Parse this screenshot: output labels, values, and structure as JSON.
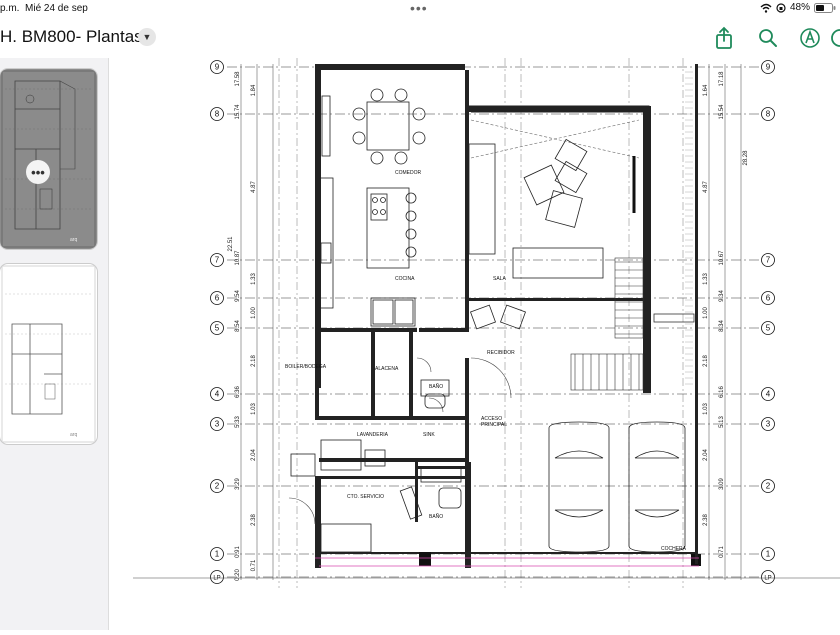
{
  "status": {
    "time": "p.m.",
    "date": "Mié 24 de sep",
    "battery": "48%"
  },
  "toolbar": {
    "title": "H. BM800- Plantas",
    "icons": [
      "share-icon",
      "search-icon",
      "markup-icon"
    ]
  },
  "sidebar": {
    "thumbnails": [
      {
        "label": "page-1",
        "selected": true
      },
      {
        "label": "page-2",
        "selected": false
      }
    ],
    "more_glyph": "•••"
  },
  "plan": {
    "grid_labels_left": [
      "9",
      "8",
      "7",
      "6",
      "5",
      "4",
      "3",
      "2",
      "1",
      "LP"
    ],
    "grid_labels_right": [
      "9",
      "8",
      "7",
      "6",
      "5",
      "4",
      "3",
      "2",
      "1",
      "LP"
    ],
    "dims_left_a": [
      "17.58",
      "15.74",
      "10.87",
      "9.54",
      "8.54",
      "6.36",
      "5.33",
      "3.29",
      "0.91",
      "0.20"
    ],
    "dims_left_b": [
      "1.84",
      "4.87",
      "1.33",
      "1.00",
      "2.18",
      "1.03",
      "2.04",
      "2.38",
      "0.71"
    ],
    "dims_left_total": "22.51",
    "dims_right_a": [
      "17.18",
      "15.54",
      "10.67",
      "9.34",
      "8.34",
      "6.16",
      "5.13",
      "3.09",
      "0.71"
    ],
    "dims_right_b": [
      "1.64",
      "4.87",
      "1.33",
      "1.00",
      "2.18",
      "1.03",
      "2.04",
      "2.38"
    ],
    "dims_right_total": "28.28",
    "rooms": {
      "comedor": "COMEDOR",
      "cocina": "COCINA",
      "sala": "SALA",
      "recibidor": "RECIBIDOR",
      "boiler": "BOILER/BODEGA",
      "alacena": "ALACENA",
      "bano1": "BAÑO",
      "acceso": "ACCESO",
      "principal": "PRINCIPAL",
      "lavanderia": "LAVANDERIA",
      "sink": "SINK",
      "servicio": "CTO. SERVICIO",
      "bano2": "BAÑO",
      "cochera": "COCHERA"
    }
  }
}
